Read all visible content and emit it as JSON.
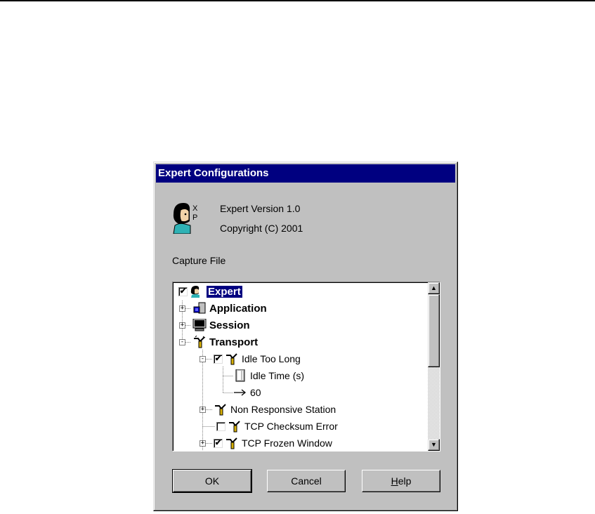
{
  "window": {
    "title": "Expert Configurations"
  },
  "about": {
    "icon": "expert-person-icon",
    "logo_letters": [
      "X",
      "P"
    ],
    "version": "Expert Version 1.0",
    "copyright": "Copyright (C) 2001"
  },
  "section_label": "Capture File",
  "tree": {
    "nodes": [
      {
        "label": "Expert",
        "icon": "expert-person-icon",
        "checked": true,
        "selected": true,
        "bold": true
      },
      {
        "label": "Application",
        "icon": "application-icon",
        "expander": "+",
        "bold": true
      },
      {
        "label": "Session",
        "icon": "monitor-icon",
        "expander": "+",
        "bold": true
      },
      {
        "label": "Transport",
        "icon": "transport-icon",
        "expander": "-",
        "bold": true
      },
      {
        "label": "Idle Too Long",
        "icon": "transport-icon",
        "expander": "-",
        "checked": true
      },
      {
        "label": "Idle Time (s)",
        "icon": "document-icon"
      },
      {
        "label": "60",
        "icon": "arrow-right-icon"
      },
      {
        "label": "Non Responsive Station",
        "icon": "transport-icon",
        "expander": "+"
      },
      {
        "label": "TCP Checksum Error",
        "icon": "transport-icon",
        "checked": false
      },
      {
        "label": "TCP Frozen Window",
        "icon": "transport-icon",
        "expander": "+",
        "checked": true
      }
    ],
    "checkmark_glyph": "✔"
  },
  "scrollbar": {
    "up_glyph": "▲",
    "down_glyph": "▼"
  },
  "buttons": {
    "ok": "OK",
    "cancel": "Cancel",
    "help_mnemonic": "H",
    "help_rest": "elp"
  }
}
